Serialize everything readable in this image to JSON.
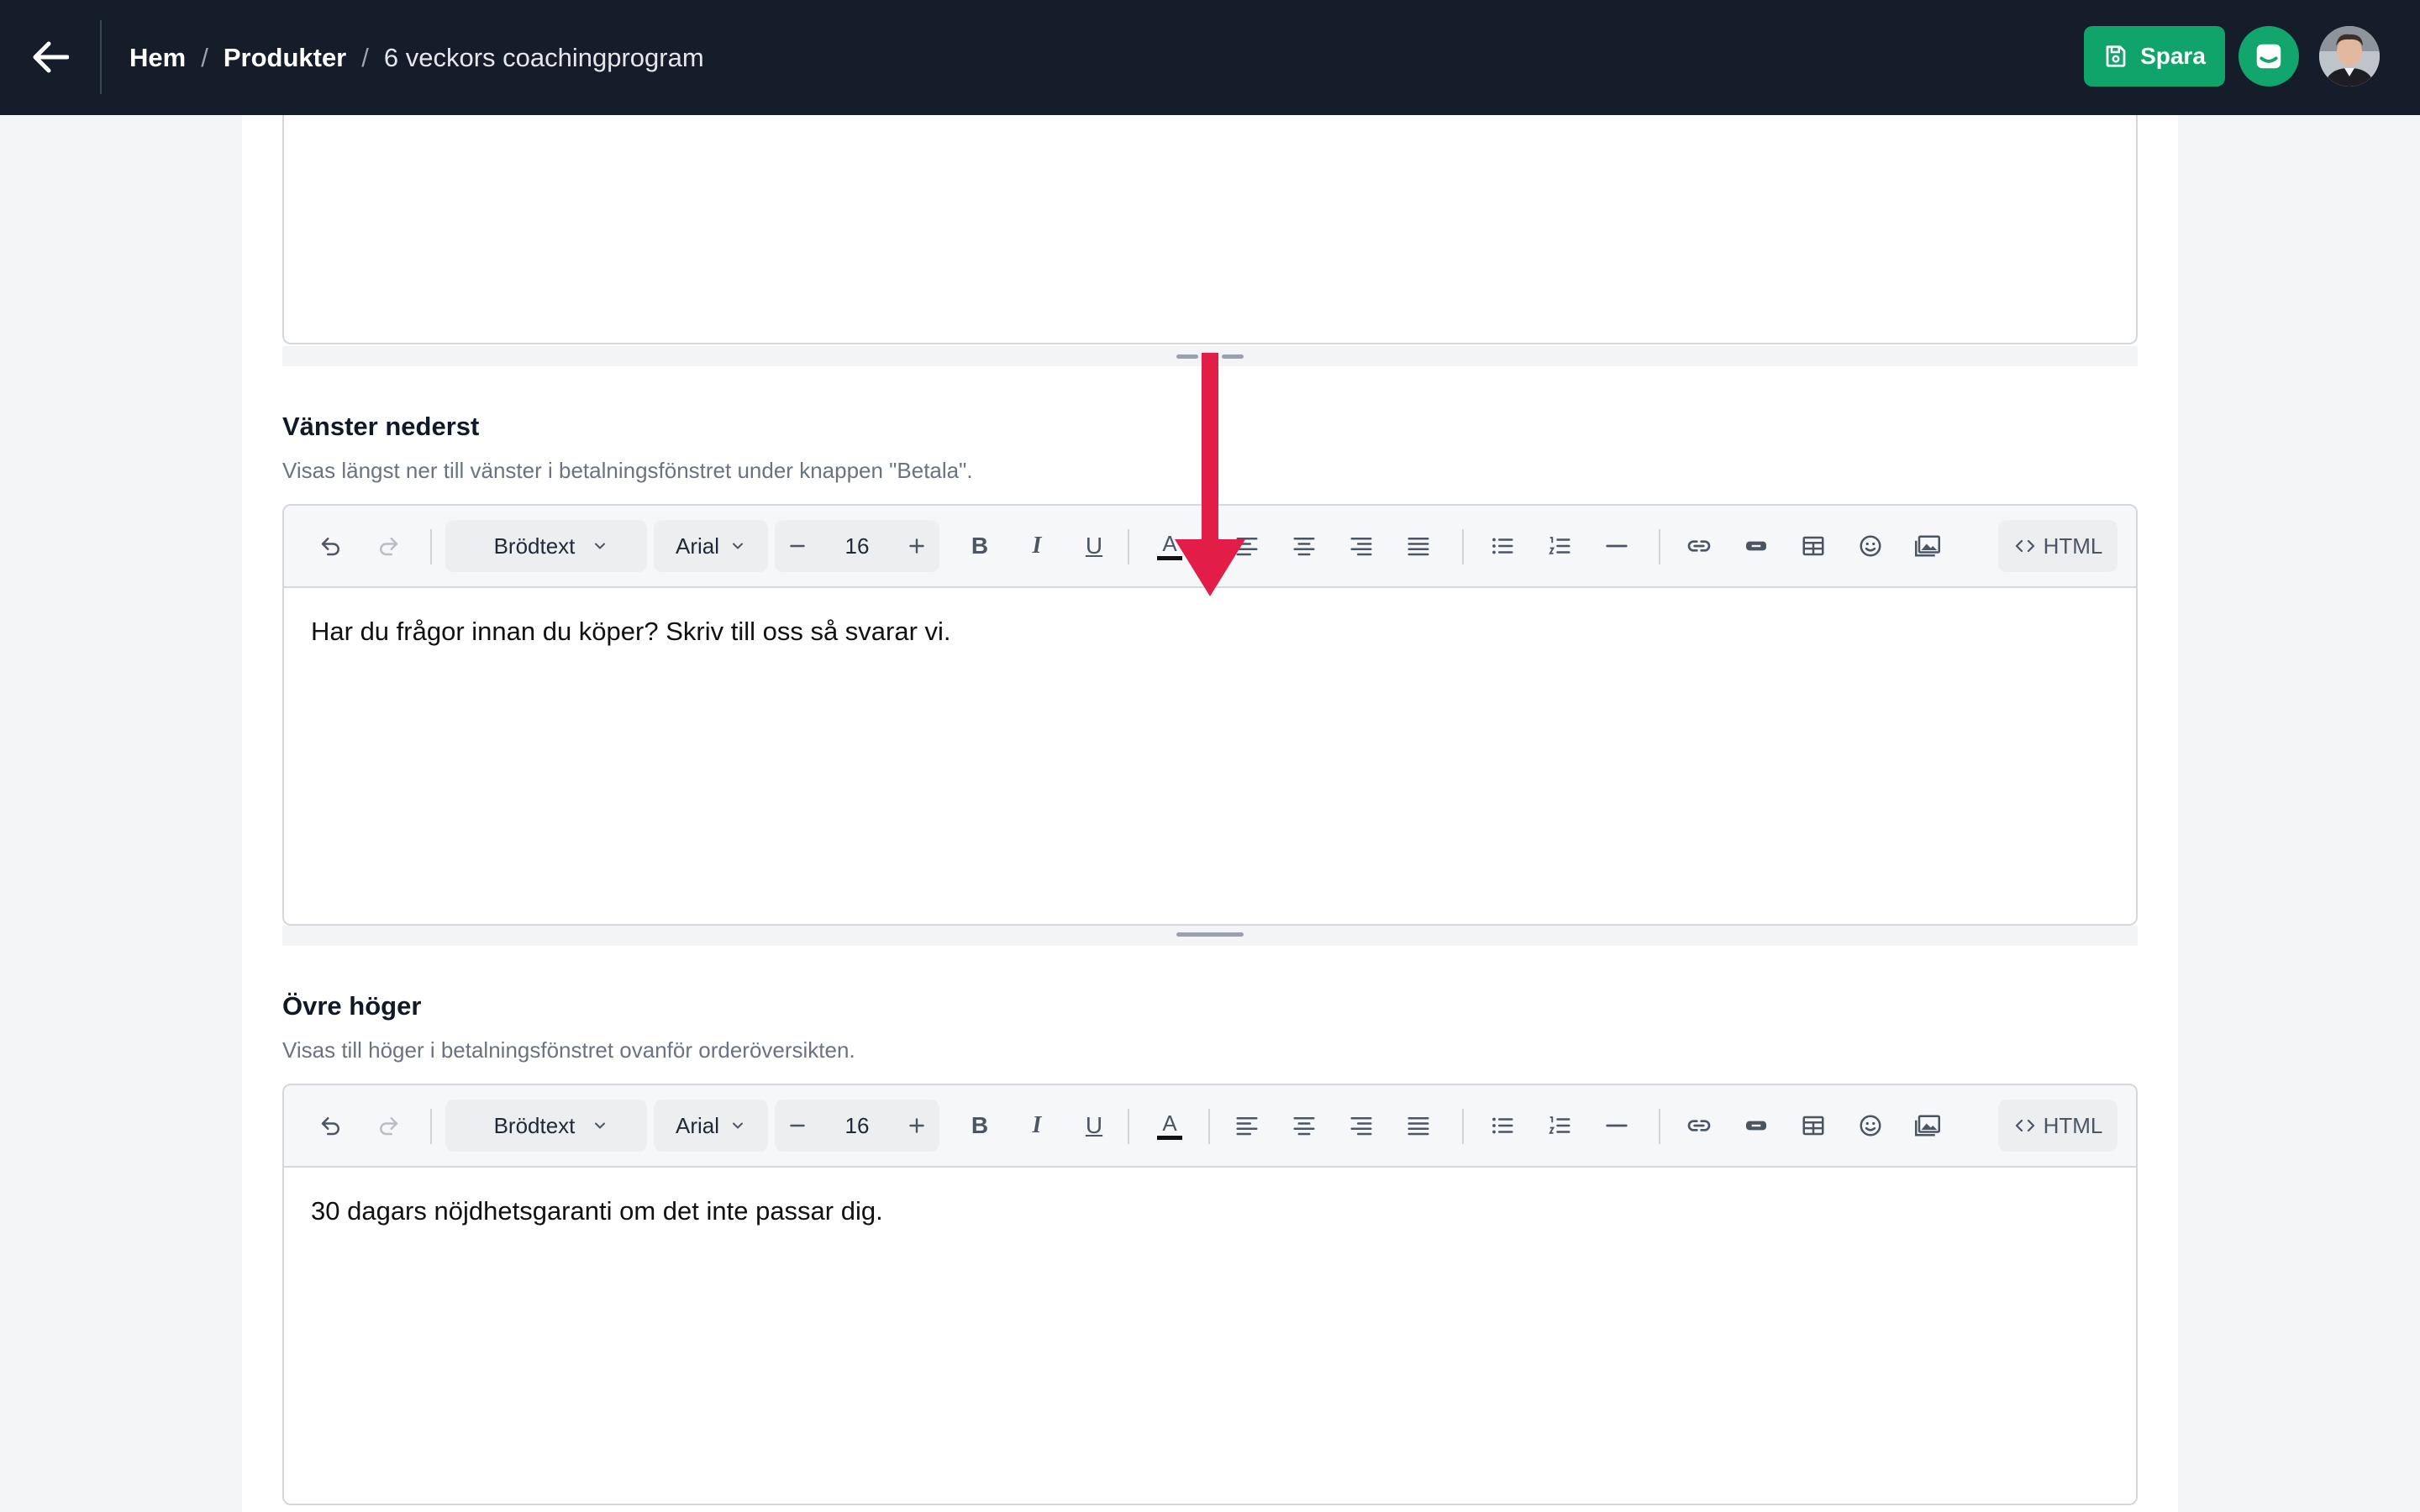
{
  "topbar": {
    "breadcrumb": {
      "home": "Hem",
      "separator": "/",
      "products": "Produkter",
      "current": "6 veckors coachingprogram"
    },
    "save_label": "Spara"
  },
  "sections": [
    {
      "title": "Vänster nederst",
      "description": "Visas längst ner till vänster i betalningsfönstret under knappen \"Betala\".",
      "content": "Har du frågor innan du köper? Skriv till oss så svarar vi."
    },
    {
      "title": "Övre höger",
      "description": "Visas till höger i betalningsfönstret ovanför orderöversikten.",
      "content": "30 dagars nöjdhetsgaranti om det inte passar dig."
    }
  ],
  "toolbar": {
    "block_format": "Brödtext",
    "font_family": "Arial",
    "font_size": "16",
    "bold": "B",
    "italic": "I",
    "underline": "U",
    "text_color": "A",
    "html_label": "HTML"
  },
  "colors": {
    "topbar": "#151d2a",
    "accent_green": "#10a36a",
    "annotation_red": "#e11d48"
  }
}
